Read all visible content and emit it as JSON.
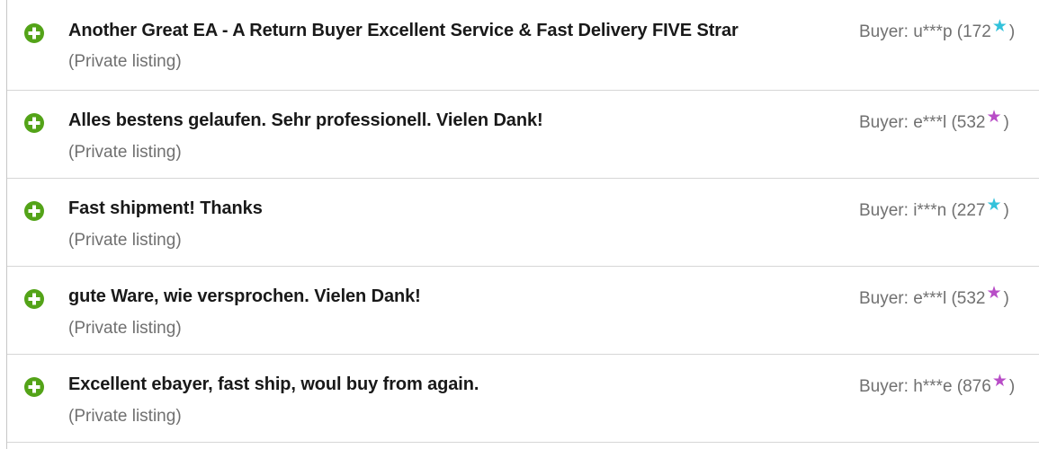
{
  "colors": {
    "positive": "#53a318",
    "star_turquoise": "#33c2db",
    "star_purple": "#b84dc7"
  },
  "feedback": [
    {
      "icon": "positive-plus-icon",
      "comment": "Another Great EA - A Return Buyer Excellent Service & Fast Delivery FIVE Strar",
      "listing": "(Private listing)",
      "buyer_prefix": "Buyer: u***p (172",
      "buyer_suffix": ")",
      "star": "★",
      "star_color": "#33c2db"
    },
    {
      "icon": "positive-plus-icon",
      "comment": "Alles bestens gelaufen. Sehr professionell. Vielen Dank!",
      "listing": "(Private listing)",
      "buyer_prefix": "Buyer: e***l (532",
      "buyer_suffix": ")",
      "star": "★",
      "star_color": "#b84dc7"
    },
    {
      "icon": "positive-plus-icon",
      "comment": "Fast shipment! Thanks",
      "listing": "(Private listing)",
      "buyer_prefix": "Buyer: i***n (227",
      "buyer_suffix": ")",
      "star": "★",
      "star_color": "#33c2db"
    },
    {
      "icon": "positive-plus-icon",
      "comment": "gute Ware, wie versprochen. Vielen Dank!",
      "listing": "(Private listing)",
      "buyer_prefix": "Buyer: e***l (532",
      "buyer_suffix": ")",
      "star": "★",
      "star_color": "#b84dc7"
    },
    {
      "icon": "positive-plus-icon",
      "comment": "Excellent ebayer, fast ship, woul buy from again.",
      "listing": "(Private listing)",
      "buyer_prefix": "Buyer: h***e (876",
      "buyer_suffix": ")",
      "star": "★",
      "star_color": "#b84dc7"
    }
  ]
}
